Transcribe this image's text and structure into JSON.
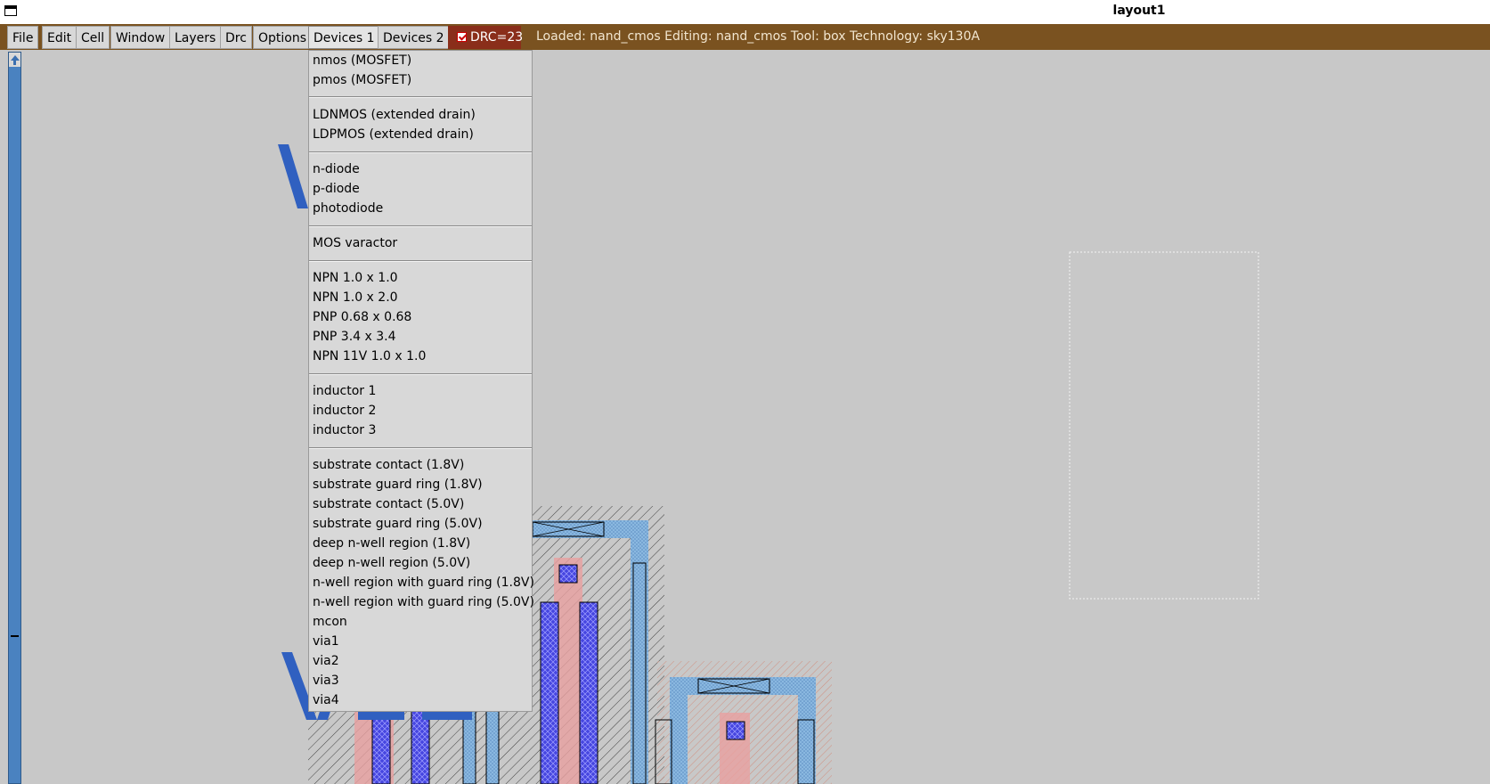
{
  "window": {
    "title": "layout1"
  },
  "menubar": {
    "file": "File",
    "edit": "Edit",
    "cell": "Cell",
    "window": "Window",
    "layers": "Layers",
    "drc": "Drc",
    "options": "Options",
    "devices1": "Devices 1",
    "devices2": "Devices 2",
    "drc_toggle": "DRC=23",
    "status": "Loaded: nand_cmos Editing: nand_cmos Tool: box  Technology: sky130A"
  },
  "devices_menu": {
    "items": [
      "nmos (MOSFET)",
      "pmos (MOSFET)",
      "LDNMOS (extended drain)",
      "LDPMOS (extended drain)",
      "n-diode",
      "p-diode",
      "photodiode",
      "MOS varactor",
      "NPN 1.0 x 1.0",
      "NPN 1.0 x 2.0",
      "PNP 0.68 x 0.68",
      "PNP 3.4 x 3.4",
      "NPN 11V 1.0 x 1.0",
      "inductor 1",
      "inductor 2",
      "inductor 3",
      "substrate contact (1.8V)",
      "substrate guard ring (1.8V)",
      "substrate contact (5.0V)",
      "substrate guard ring (5.0V)",
      "deep n-well region (1.8V)",
      "deep n-well region (5.0V)",
      "n-well region with guard ring (1.8V)",
      "n-well region with guard ring (5.0V)",
      "mcon",
      "via1",
      "via2",
      "via3",
      "via4"
    ]
  },
  "colors": {
    "menubar_bg": "#7a5220",
    "drc_bg": "#8a2e1a",
    "canvas_bg": "#c8c8c8",
    "label_blue": "#3060c0",
    "metal_blue": "#3a3ad8",
    "poly_red": "#e08080"
  }
}
